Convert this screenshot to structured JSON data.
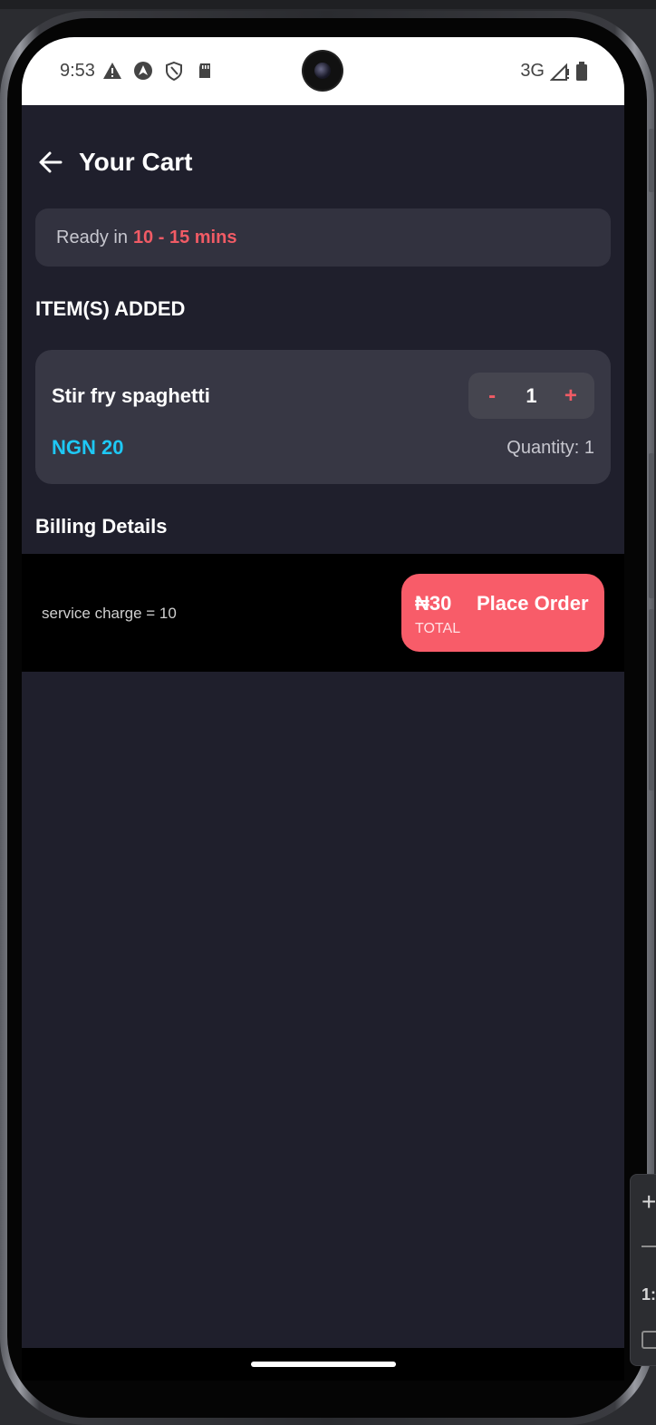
{
  "status_bar": {
    "time": "9:53",
    "network": "3G",
    "icons": [
      "warning-icon",
      "navigation-icon",
      "shield-icon",
      "sd-card-icon",
      "signal-icon",
      "battery-icon"
    ]
  },
  "header": {
    "title": "Your Cart",
    "back_icon": "arrow-left-icon"
  },
  "ready_notice": {
    "prefix": "Ready in",
    "time": "10 - 15 mins"
  },
  "items_section": {
    "title": "ITEM(S) ADDED",
    "items": [
      {
        "name": "Stir fry spaghetti",
        "price": "NGN 20",
        "quantity_label": "Quantity: 1",
        "stepper": {
          "decrement": "-",
          "value": "1",
          "increment": "+"
        }
      }
    ]
  },
  "billing": {
    "title": "Billing Details",
    "service_charge": "service charge = 10",
    "total": "₦30",
    "total_label": "TOTAL",
    "place_order_label": "Place Order"
  },
  "colors": {
    "background": "#1f1f2c",
    "card": "#373744",
    "accent_red": "#f85c69",
    "price_blue": "#1ec8f5"
  },
  "side_panel": {
    "ratio_label": "1:"
  }
}
